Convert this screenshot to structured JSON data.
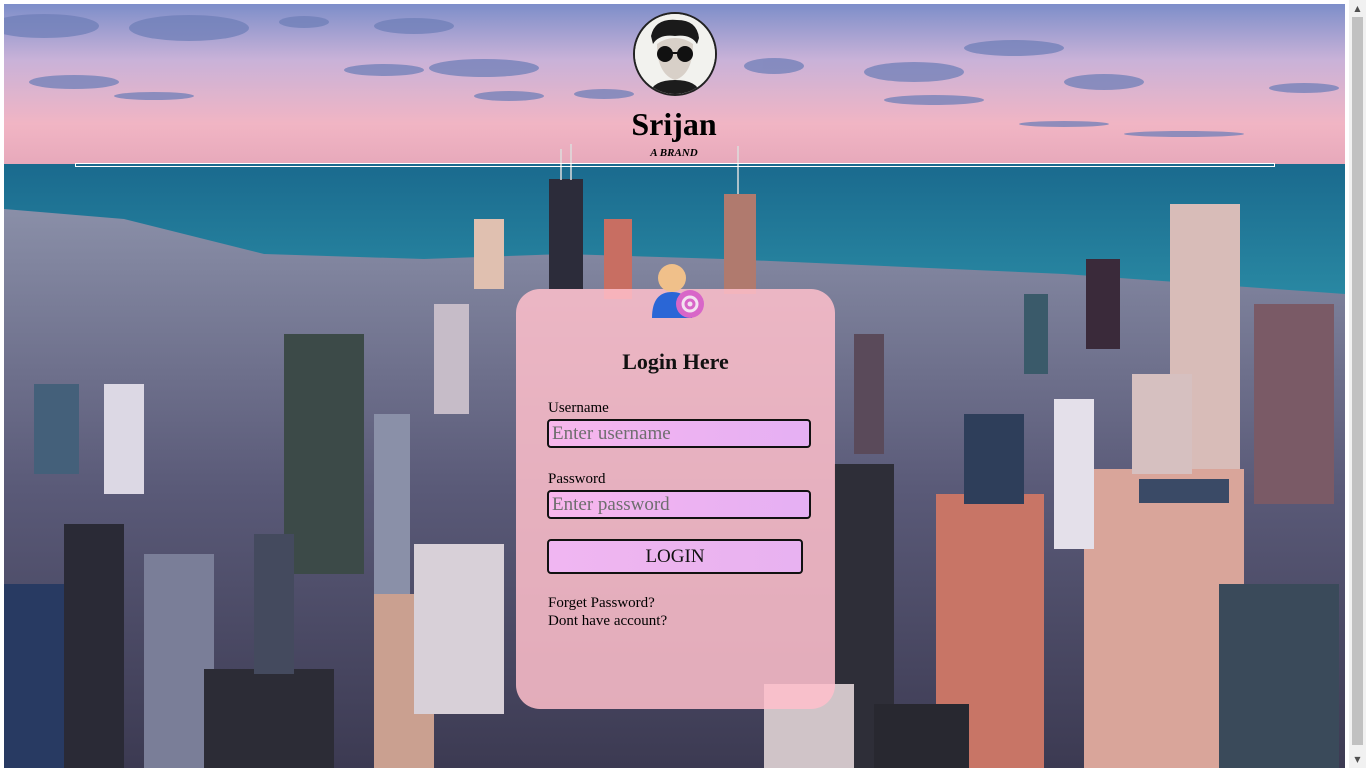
{
  "brand": {
    "name": "Srijan",
    "tagline": "A BRAND"
  },
  "login": {
    "title": "Login Here",
    "username_label": "Username",
    "username_placeholder": "Enter username",
    "username_value": "",
    "password_label": "Password",
    "password_placeholder": "Enter password",
    "password_value": "",
    "submit_label": "LOGIN",
    "forgot_link": "Forget Password?",
    "signup_link": "Dont have account?"
  },
  "icons": {
    "avatar": "profile-photo-sunglasses",
    "login_icon": "user-email-icon",
    "scroll_up": "triangle-up-icon",
    "scroll_down": "triangle-down-icon"
  },
  "colors": {
    "card_background": "#ffc0cb",
    "input_background": "#f0b6f2",
    "sky_top": "#6f86c0",
    "sky_bottom": "#f2b8c2",
    "sea": "#1c7a9a"
  }
}
